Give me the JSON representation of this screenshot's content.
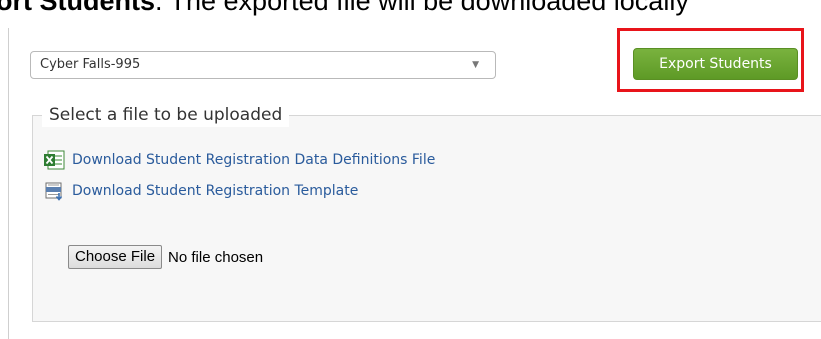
{
  "caption": {
    "bold_text": "ort Students",
    "rest_text": ". The exported file will be downloaded locally"
  },
  "filter": {
    "selected": "Cyber Falls-995",
    "caret": "▼"
  },
  "export": {
    "label": "Export Students",
    "color": "#6aa62f",
    "highlight_color": "#e8141a"
  },
  "upload": {
    "legend": "Select a file to be uploaded",
    "links": [
      {
        "label": "Download Student Registration Data Definitions File",
        "icon": "excel-file-icon"
      },
      {
        "label": "Download Student Registration Template",
        "icon": "csv-file-icon"
      }
    ],
    "choose_file_label": "Choose File",
    "no_file_text": "No file chosen"
  }
}
